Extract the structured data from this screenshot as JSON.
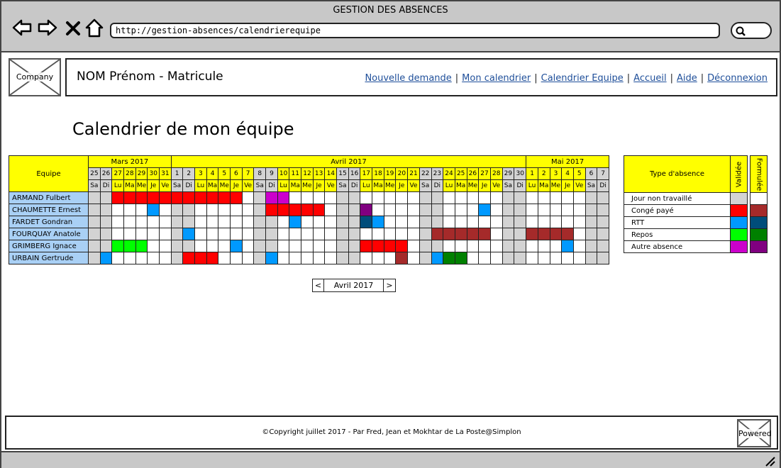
{
  "window": {
    "title": "GESTION DES ABSENCES",
    "url": "http://gestion-absences/calendrierequipe"
  },
  "header": {
    "logo_label": "Company",
    "user": "NOM Prénom - Matricule",
    "nav": [
      "Nouvelle demande",
      "Mon calendrier",
      "Calendrier Equipe",
      "Accueil",
      "Aide",
      "Déconnexion"
    ]
  },
  "page_title": "Calendrier de mon équipe",
  "calendar": {
    "team_header": "Equipe",
    "months": [
      {
        "label": "Mars 2017",
        "days": [
          "25",
          "26",
          "27",
          "28",
          "29",
          "30",
          "31"
        ],
        "weekdays": [
          "Sa",
          "Di",
          "Lu",
          "Ma",
          "Me",
          "Je",
          "Ve"
        ]
      },
      {
        "label": "Avril 2017",
        "days": [
          "1",
          "2",
          "3",
          "4",
          "5",
          "6",
          "7",
          "8",
          "9",
          "10",
          "11",
          "12",
          "13",
          "14",
          "15",
          "16",
          "17",
          "18",
          "19",
          "20",
          "21",
          "22",
          "23",
          "24",
          "25",
          "26",
          "27",
          "28",
          "29",
          "30"
        ],
        "weekdays": [
          "Sa",
          "Di",
          "Lu",
          "Ma",
          "Me",
          "Je",
          "Ve",
          "Sa",
          "Di",
          "Lu",
          "Ma",
          "Me",
          "Je",
          "Ve",
          "Sa",
          "Di",
          "Lu",
          "Ma",
          "Me",
          "Je",
          "Ve",
          "Sa",
          "Di",
          "Lu",
          "Ma",
          "Me",
          "Je",
          "Ve",
          "Sa",
          "Di"
        ]
      },
      {
        "label": "Mai 2017",
        "days": [
          "1",
          "2",
          "3",
          "4",
          "5",
          "6",
          "7"
        ],
        "weekdays": [
          "Lu",
          "Ma",
          "Me",
          "Je",
          "Ve",
          "Sa",
          "Di"
        ]
      }
    ],
    "members": [
      {
        "name": "ARMAND Fulbert",
        "absences": {
          "3": "cp_v",
          "4": "cp_v",
          "5": "cp_v",
          "6": "cp_v",
          "7": "cp_v",
          "8": "cp_v",
          "9": "cp_v",
          "10": "cp_v",
          "11": "cp_v",
          "12": "cp_v",
          "13": "cp_v",
          "16": "autre_v",
          "17": "autre_v"
        }
      },
      {
        "name": "CHAUMETTE Ernest",
        "absences": {
          "6": "rtt_v",
          "16": "cp_v",
          "17": "cp_v",
          "18": "cp_v",
          "19": "cp_v",
          "20": "cp_v",
          "24": "autre_f",
          "34": "rtt_v"
        }
      },
      {
        "name": "FARDET Gondran",
        "absences": {
          "18": "rtt_v",
          "24": "rtt_f",
          "25": "rtt_v"
        }
      },
      {
        "name": "FOURQUAY Anatole",
        "absences": {
          "9": "rtt_v",
          "30": "cp_f",
          "31": "cp_f",
          "32": "cp_f",
          "33": "cp_f",
          "34": "cp_f",
          "38": "cp_f",
          "39": "cp_f",
          "40": "cp_f",
          "41": "cp_f"
        }
      },
      {
        "name": "GRIMBERG Ignace",
        "absences": {
          "3": "repos_v",
          "4": "repos_v",
          "5": "repos_v",
          "13": "rtt_v",
          "24": "cp_v",
          "25": "cp_v",
          "26": "cp_v",
          "27": "cp_v",
          "41": "rtt_v"
        }
      },
      {
        "name": "URBAIN Gertrude",
        "absences": {
          "2": "rtt_v",
          "9": "cp_v",
          "10": "cp_v",
          "11": "cp_v",
          "16": "rtt_v",
          "27": "cp_f",
          "30": "rtt_v",
          "31": "repos_f",
          "32": "repos_f"
        }
      }
    ]
  },
  "legend": {
    "header": "Type d'absence",
    "validated_header": "Validée",
    "formulated_header": "Formulée",
    "rows": [
      {
        "label": "Jour non travaillé",
        "validated": "#d3d3d3",
        "formulated": "#ffffff"
      },
      {
        "label": "Congé payé",
        "validated": "#ff0000",
        "formulated": "#a52a2a"
      },
      {
        "label": "RTT",
        "validated": "#0099ff",
        "formulated": "#004d7a"
      },
      {
        "label": "Repos",
        "validated": "#00ff00",
        "formulated": "#008000"
      },
      {
        "label": "Autre absence",
        "validated": "#cc00cc",
        "formulated": "#800080"
      }
    ]
  },
  "colors": {
    "cp_v": "#ff0000",
    "cp_f": "#a52a2a",
    "rtt_v": "#0099ff",
    "rtt_f": "#004d7a",
    "repos_v": "#00ff00",
    "repos_f": "#008000",
    "autre_v": "#cc00cc",
    "autre_f": "#800080",
    "weekend": "#d3d3d3",
    "header": "#ffff00",
    "member": "#a9d0f5"
  },
  "pager": {
    "prev": "<",
    "current": "Avril 2017",
    "next": ">"
  },
  "footer": {
    "copyright": "©Copyright juillet 2017 - Par Fred, Jean et Mokhtar de La Poste@Simplon",
    "powered_label": "Powered"
  }
}
